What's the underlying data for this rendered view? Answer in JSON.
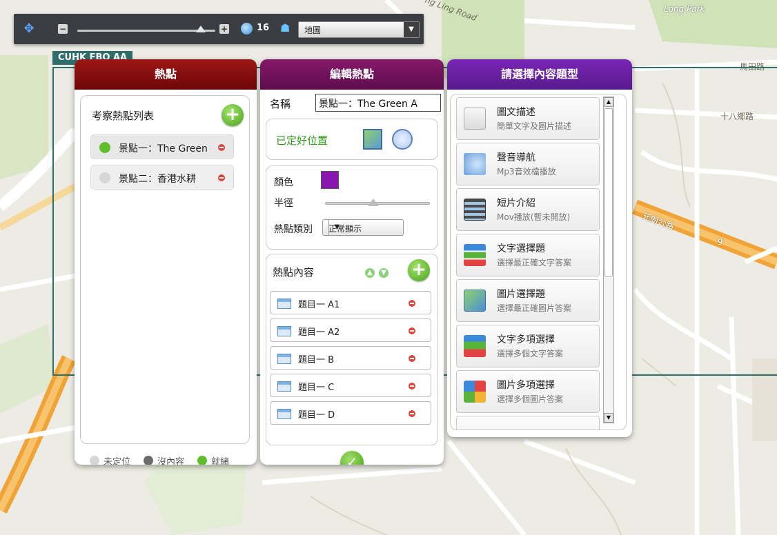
{
  "toolbar": {
    "zoom_level": "16",
    "map_type": "地圖"
  },
  "region_label": "CUHK FBO AA",
  "map_labels": {
    "ma_tin_road": "馬田路",
    "shap_pat_heung": "十八鄉路",
    "yuen_long_hwy": "元朗公路",
    "road_9": "9",
    "long_park": "Long Park",
    "ching_ling_road": "ng Ling Road"
  },
  "hotspots_panel": {
    "title": "熱點",
    "list_title": "考察熱點列表",
    "items": [
      {
        "label": "景點一：The Green A",
        "status_color": "#5fbf2a"
      },
      {
        "label": "景點二：香港水耕",
        "status_color": "#d6d6d6"
      }
    ],
    "legend": {
      "unlocated": "未定位",
      "no_content": "沒內容",
      "ready": "就緒"
    }
  },
  "edit_panel": {
    "title": "編輯熱點",
    "name_label": "名稱",
    "name_value": "景點一：The Green A",
    "location_status": "已定好位置",
    "color_label": "顏色",
    "color_value": "#8a16b0",
    "radius_label": "半徑",
    "category_label": "熱點類別",
    "category_value": "正常顯示",
    "content_title": "熱點內容",
    "questions": [
      "題目一 A1",
      "題目一 A2",
      "題目一 B",
      "題目一 C",
      "題目一 D"
    ]
  },
  "types_panel": {
    "title": "請選擇內容題型",
    "items": [
      {
        "title": "圖文描述",
        "sub": "簡單文字及圖片描述"
      },
      {
        "title": "聲音導航",
        "sub": "Mp3音效檔播放"
      },
      {
        "title": "短片介紹",
        "sub": "Mov播放(暫未開放)"
      },
      {
        "title": "文字選擇題",
        "sub": "選擇最正確文字答案"
      },
      {
        "title": "圖片選擇題",
        "sub": "選擇最正確圖片答案"
      },
      {
        "title": "文字多項選擇",
        "sub": "選擇多個文字答案"
      },
      {
        "title": "圖片多項選擇",
        "sub": "選擇多個圖片答案"
      }
    ]
  }
}
